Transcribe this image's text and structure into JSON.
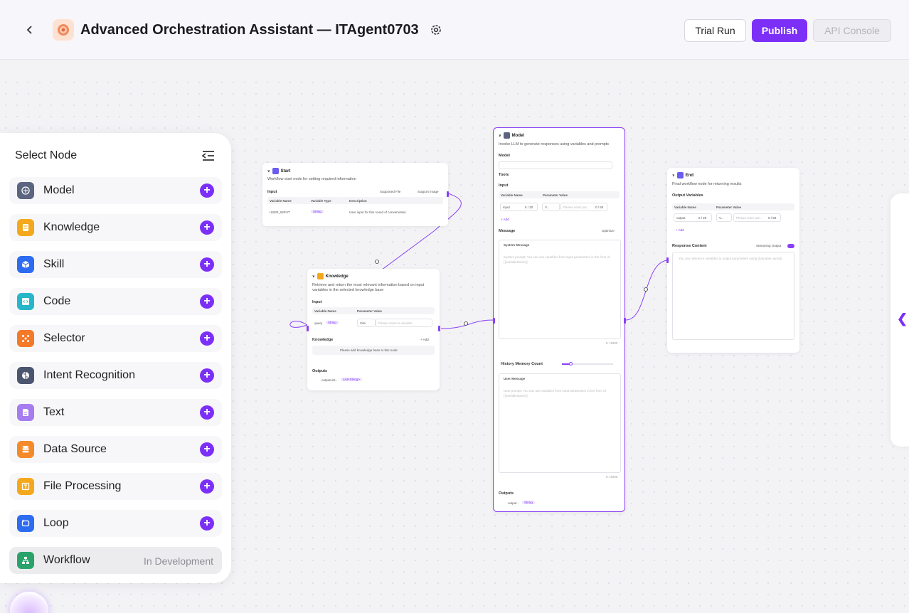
{
  "header": {
    "title": "Advanced Orchestration Assistant — ITAgent0703",
    "trial_run": "Trial Run",
    "publish": "Publish",
    "api_console": "API Console"
  },
  "panel": {
    "title": "Select Node",
    "items": [
      {
        "label": "Model",
        "color": "#5b6580"
      },
      {
        "label": "Knowledge",
        "color": "#f4a81d"
      },
      {
        "label": "Skill",
        "color": "#2d6cf0"
      },
      {
        "label": "Code",
        "color": "#27b6c9"
      },
      {
        "label": "Selector",
        "color": "#f47a2a"
      },
      {
        "label": "Intent Recognition",
        "color": "#4b5570"
      },
      {
        "label": "Text",
        "color": "#a77cf0"
      },
      {
        "label": "Data Source",
        "color": "#f48a2a"
      },
      {
        "label": "File Processing",
        "color": "#f4a81d"
      },
      {
        "label": "Loop",
        "color": "#2d6cf0"
      }
    ],
    "workflow": {
      "label": "Workflow",
      "status": "In Development",
      "color": "#2aa36b"
    }
  },
  "start_node": {
    "title": "Start",
    "desc": "Workflow start node for setting required information",
    "input_label": "Input",
    "supported_file": "Supported File",
    "support_image": "Support Image",
    "col_name": "Variable Name",
    "col_type": "Variable Type",
    "col_desc": "Description",
    "row_name": "USER_INPUT",
    "row_type": "String",
    "row_desc": "User input for this round of conversation"
  },
  "knowledge_node": {
    "title": "Knowledge",
    "desc": "Retrieve and return the most relevant information based on input variables in the selected knowledge base",
    "input_label": "Input",
    "col_name": "Variable Name",
    "col_value": "Parameter Value",
    "row_name": "query",
    "row_type": "String",
    "row_cite": "Cite",
    "row_placeholder": "Please select a variable",
    "knowledge_label": "Knowledge",
    "add": "+ Add",
    "empty": "Please add knowledge base to this node",
    "outputs_label": "Outputs",
    "output_name": "outputList -",
    "output_type": "List<String>"
  },
  "model_node": {
    "title": "Model",
    "desc": "Invoke LLM to generate responses using variables and prompts",
    "model_label": "Model",
    "tools_label": "Tools",
    "input_label": "Input",
    "col_name": "Variable Name",
    "col_value": "Parameter Value",
    "row_name": "input",
    "row_count": "5 / 20",
    "row_sel": "V...",
    "row_placeholder": "Please enter par...",
    "row_count2": "0 / 50",
    "add": "+ Add",
    "message_label": "Message",
    "optimize": "Optimize",
    "system_label": "System Message",
    "system_ph": "System prompt: You can use variables from input parameters in the form of {{variableName}}",
    "system_count": "0 / 2000",
    "history_label": "History Memory Count",
    "user_label": "User Message",
    "user_ph": "User prompt: You can use variables from input parameters in the form of {{variableName}}",
    "user_count": "0 / 2000",
    "outputs_label": "Outputs",
    "output_name": "output -",
    "output_type": "String"
  },
  "end_node": {
    "title": "End",
    "desc": "Final workflow node for returning results",
    "output_vars": "Output Variables",
    "col_name": "Variable Name",
    "col_value": "Parameter Value",
    "row_name": "output",
    "row_count": "6 / 20",
    "row_sel": "V...",
    "row_placeholder": "Please enter par...",
    "row_count2": "0 / 50",
    "add": "+ Add",
    "response_label": "Response Content",
    "streaming": "Streaming Output",
    "response_ph": "You can reference variables in output parameters using {{variable name}}"
  }
}
